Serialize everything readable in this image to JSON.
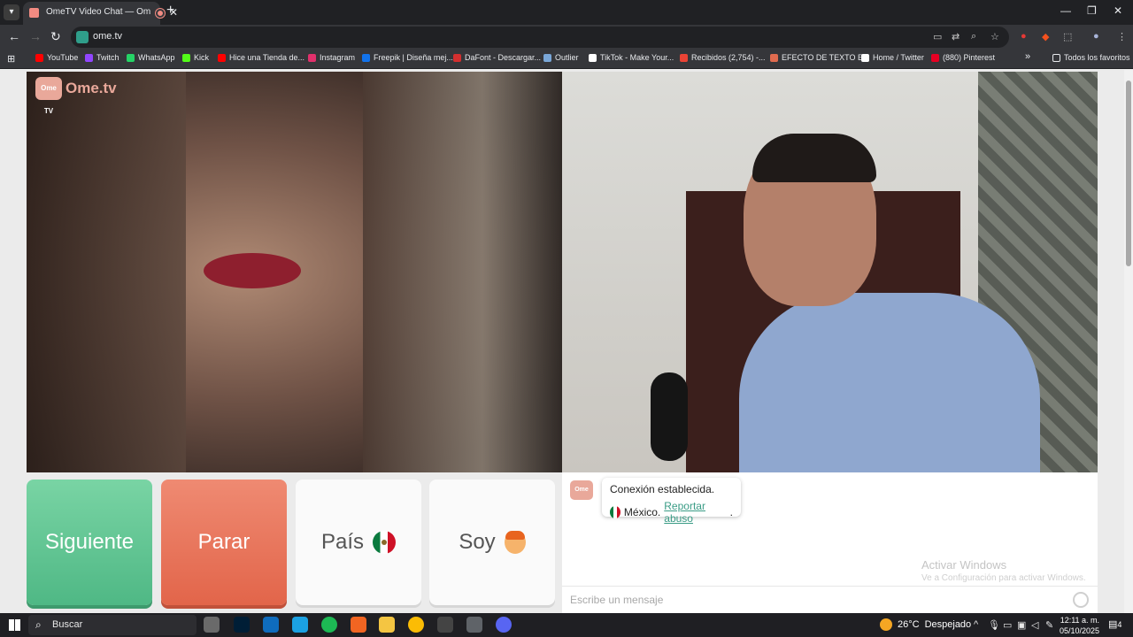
{
  "browser": {
    "tab_title": "OmeTV Video Chat — Ome",
    "tab_close": "✕",
    "new_tab": "+",
    "url": "ome.tv",
    "window_controls": [
      "—",
      "❐",
      "✕"
    ],
    "bookmarks": [
      {
        "label": "YouTube",
        "color": "#ff0000"
      },
      {
        "label": "Twitch",
        "color": "#9146ff"
      },
      {
        "label": "WhatsApp",
        "color": "#25d366"
      },
      {
        "label": "Kick",
        "color": "#53fc18"
      },
      {
        "label": "Hice una Tienda de...",
        "color": "#ff0000"
      },
      {
        "label": "Instagram",
        "color": "#e1306c"
      },
      {
        "label": "Freepik | Diseña mej...",
        "color": "#1273eb"
      },
      {
        "label": "DaFont - Descargar...",
        "color": "#d32f2f"
      },
      {
        "label": "Outlier",
        "color": "#7aa7d8"
      },
      {
        "label": "TikTok - Make Your...",
        "color": "#ffffff"
      },
      {
        "label": "Recibidos (2,754) -...",
        "color": "#ea4335"
      },
      {
        "label": "EFECTO DE TEXTO E...",
        "color": "#e06b4f"
      },
      {
        "label": "Home / Twitter",
        "color": "#ffffff"
      },
      {
        "label": "(880) Pinterest",
        "color": "#e60023"
      }
    ],
    "more_bookmarks": "»",
    "all_favorites": "Todos los favoritos"
  },
  "page": {
    "logo_text": "Ome.tv",
    "logo_badge": "Ome TV",
    "buttons": {
      "next": "Siguiente",
      "stop": "Parar",
      "country": "País",
      "me": "Soy"
    },
    "chat": {
      "status": "Conexión establecida.",
      "country": "México.",
      "report": "Reportar abuso",
      "report_suffix": ".",
      "input_placeholder": "Escribe un mensaje",
      "watermark_title": "Activar Windows",
      "watermark_sub": "Ve a Configuración para activar Windows."
    }
  },
  "taskbar": {
    "search_label": "Buscar",
    "temperature": "26°C",
    "weather": "Despejado",
    "time": "12:11 a. m.",
    "date": "05/10/2025",
    "notifications": "4"
  },
  "colors": {
    "next": "#4fb885",
    "stop": "#e2654a",
    "brand": "#e9a89a",
    "link": "#3a9c86"
  }
}
